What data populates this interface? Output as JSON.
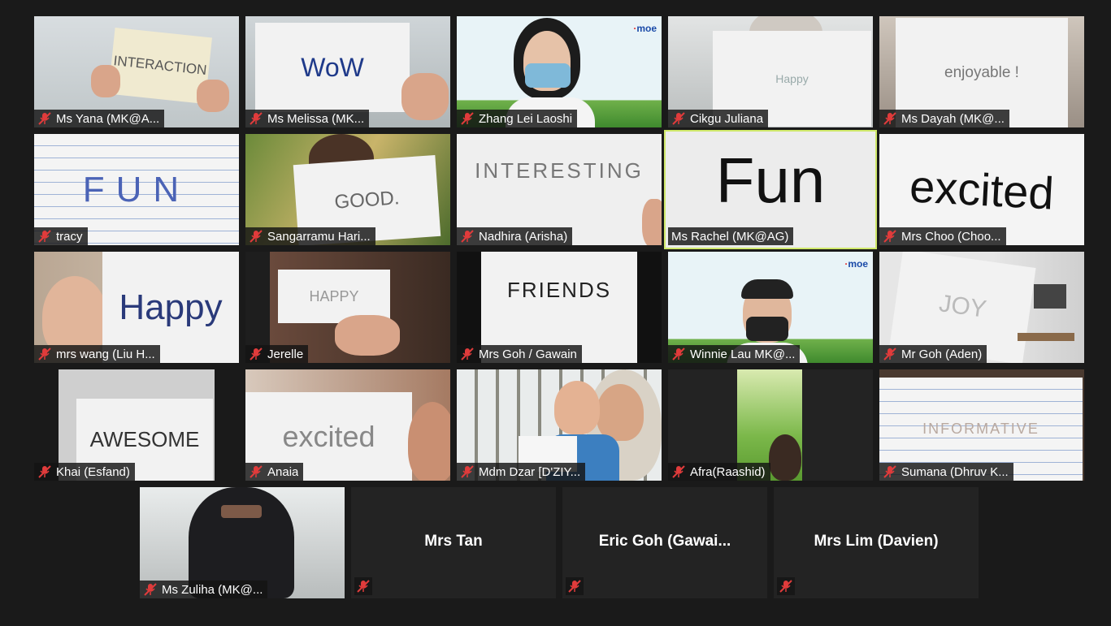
{
  "participants": [
    {
      "name": "Ms Yana (MK@A...",
      "sign": "INTERACTION"
    },
    {
      "name": "Ms Melissa (MK...",
      "sign": "WoW"
    },
    {
      "name": "Zhang Lei Laoshi",
      "sign": ""
    },
    {
      "name": "Cikgu Juliana",
      "sign": "Happy"
    },
    {
      "name": "Ms Dayah (MK@...",
      "sign": "enjoyable !"
    },
    {
      "name": "tracy",
      "sign": "FUN"
    },
    {
      "name": "Sangarramu Hari...",
      "sign": "GOOD."
    },
    {
      "name": "Nadhira (Arisha)",
      "sign": "INTERESTING"
    },
    {
      "name": "Ms Rachel (MK@AG)",
      "sign": "Fun"
    },
    {
      "name": "Mrs Choo (Choo...",
      "sign": "excited"
    },
    {
      "name": "mrs wang (Liu H...",
      "sign": "Happy"
    },
    {
      "name": "Jerelle",
      "sign": "HAPPY"
    },
    {
      "name": "Mrs Goh / Gawain",
      "sign": "FRIENDS"
    },
    {
      "name": "Winnie Lau MK@...",
      "sign": ""
    },
    {
      "name": "Mr Goh (Aden)",
      "sign": "JOY"
    },
    {
      "name": "Khai (Esfand)",
      "sign": "AWESOME"
    },
    {
      "name": "Anaia",
      "sign": "excited"
    },
    {
      "name": "Mdm Dzar [D'ZIY...",
      "sign": ""
    },
    {
      "name": "Afra(Raashid)",
      "sign": ""
    },
    {
      "name": "Sumana (Dhruv K...",
      "sign": "INFORMATIVE"
    },
    {
      "name": "Ms Zuliha (MK@...",
      "sign": ""
    }
  ],
  "no_video_participants": [
    {
      "name": "Mrs Tan"
    },
    {
      "name": "Eric Goh (Gawai..."
    },
    {
      "name": "Mrs Lim (Davien)"
    }
  ],
  "moe_logo": {
    "text": "moe"
  },
  "colors": {
    "background": "#1a1a1a",
    "active_speaker_border": "#cfe86a",
    "muted_mic": "#e03b3b"
  },
  "icons": {
    "mic": "muted-mic-icon"
  }
}
